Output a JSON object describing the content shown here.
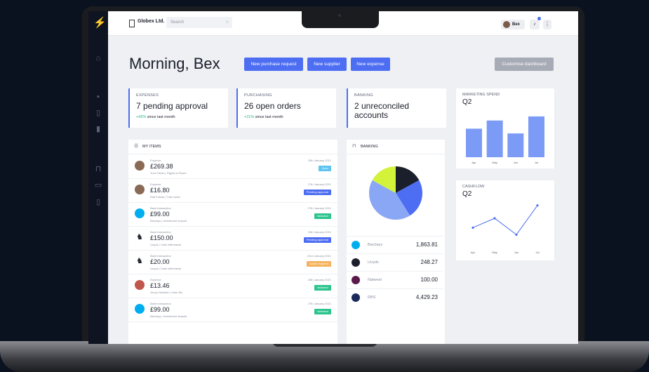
{
  "topbar": {
    "company": "Globex Ltd.",
    "search_placeholder": "Search",
    "user_name": "Bex"
  },
  "greeting": "Morning, Bex",
  "actions": {
    "new_purchase_request": "New purchase request",
    "new_supplier": "New supplier",
    "new_expense": "New expense",
    "customise_dashboard": "Customise dashboard"
  },
  "cards": {
    "expenses": {
      "label": "EXPENSES",
      "main": "7 pending approval",
      "change": "+42%",
      "change_text": "since last month"
    },
    "purchasing": {
      "label": "PURCHASING",
      "main": "26 open orders",
      "change": "+21%",
      "change_text": "since last month"
    },
    "banking": {
      "label": "BANKING",
      "main_line1": "2 unreconciled",
      "main_line2": "accounts"
    }
  },
  "my_items": {
    "title": "MY ITEMS",
    "items": [
      {
        "type": "Expense",
        "amount": "£269.38",
        "desc": "Tron Fisher | Flights to Rome",
        "date": "20th January 2021",
        "status": "Open",
        "status_color": "#5ec3ef",
        "avatar": "person"
      },
      {
        "type": "Expense",
        "amount": "£16.80",
        "desc": "Ralf Faizan | Train ticket",
        "date": "27th January 2021",
        "status": "Pending approval",
        "status_color": "#4d6df2",
        "avatar": "person"
      },
      {
        "type": "Bank transaction",
        "amount": "£99.00",
        "desc": "Barclays | Investment deposit",
        "date": "27th January 2021",
        "status": "Validated",
        "status_color": "#2cc48d",
        "avatar": "barclays"
      },
      {
        "type": "Bank transaction",
        "amount": "£150.00",
        "desc": "Lloyds | Cash withdrawal",
        "date": "24th January 2021",
        "status": "Pending approval",
        "status_color": "#4d6df2",
        "avatar": "lloyds"
      },
      {
        "type": "Bank transaction",
        "amount": "£20.00",
        "desc": "Lloyds | Cash withdrawal",
        "date": "22nd January 2021",
        "status": "Action required",
        "status_color": "#f5b35b",
        "avatar": "lloyds"
      },
      {
        "type": "Expense",
        "amount": "£13.46",
        "desc": "Jenny Hamilton | Uber Biz",
        "date": "20th January 2021",
        "status": "Validated",
        "status_color": "#2cc48d",
        "avatar": "person2"
      },
      {
        "type": "Bank transaction",
        "amount": "£99.00",
        "desc": "Barclays | Investment deposit",
        "date": "27th January 2021",
        "status": "Validated",
        "status_color": "#2cc48d",
        "avatar": "barclays"
      }
    ]
  },
  "banking_panel": {
    "title": "BANKING",
    "accounts": [
      {
        "name": "Barclays",
        "value": "1,863.81",
        "color": "#00aeef"
      },
      {
        "name": "Lloyds",
        "value": "248.27",
        "color": "#1b1f2b"
      },
      {
        "name": "Natwest",
        "value": "100.00",
        "color": "#5a1a4a"
      },
      {
        "name": "RBS",
        "value": "4,429.23",
        "color": "#1b2a5b"
      }
    ],
    "pie_colors": [
      "#1b1f2b",
      "#4d6df2",
      "#8aa7f5",
      "#d3f23a"
    ]
  },
  "chart_data": [
    {
      "type": "bar",
      "title": "MARKETING SPEND",
      "subtitle": "Q2",
      "categories": [
        "Apr",
        "May",
        "Jun",
        "Jul"
      ],
      "values": [
        42,
        54,
        35,
        60
      ],
      "color": "#7c9bf7"
    },
    {
      "type": "line",
      "title": "CASHFLOW",
      "subtitle": "Q2",
      "categories": [
        "Apr",
        "May",
        "Jun",
        "Jul"
      ],
      "x": [
        "Apr",
        "May",
        "Jun",
        "Jul"
      ],
      "values": [
        20,
        36,
        8,
        58
      ],
      "color": "#4d6df2"
    },
    {
      "type": "pie",
      "title": "BANKING",
      "values": [
        17,
        24,
        42,
        17
      ]
    }
  ]
}
